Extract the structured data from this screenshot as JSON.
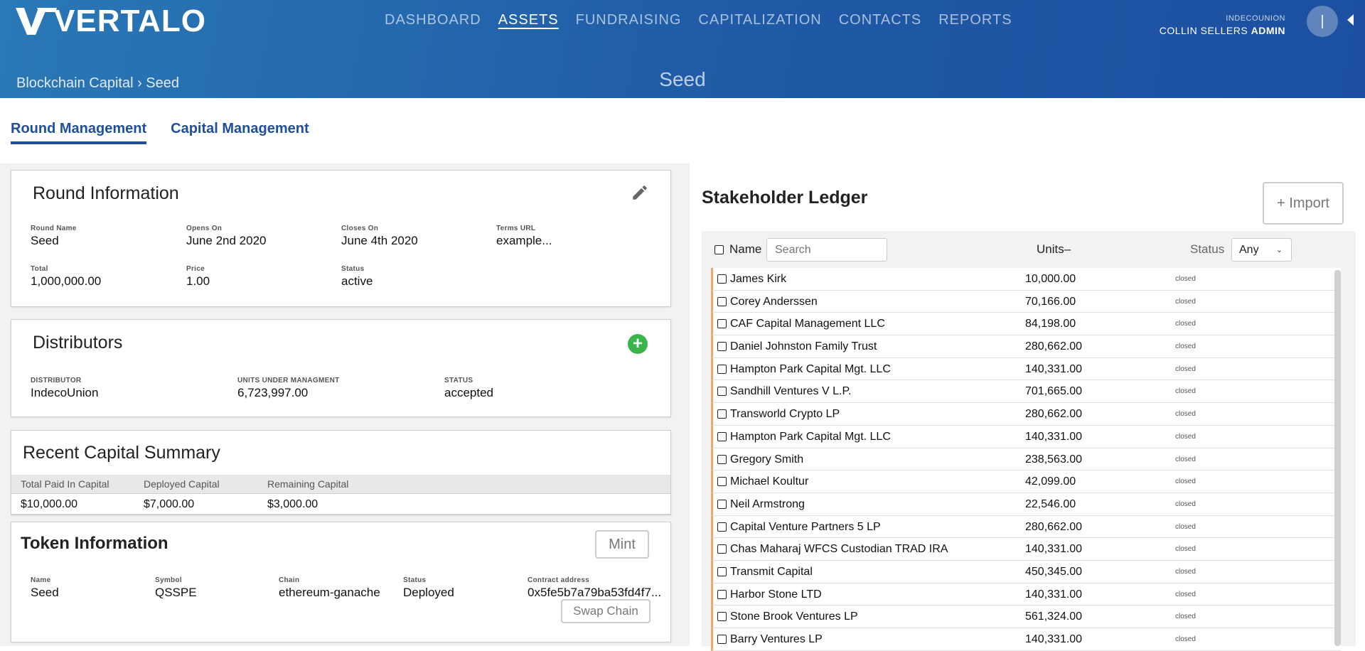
{
  "header": {
    "logo_text": "VERTALO",
    "nav": [
      "DASHBOARD",
      "ASSETS",
      "FUNDRAISING",
      "CAPITALIZATION",
      "CONTACTS",
      "REPORTS"
    ],
    "active_nav": "ASSETS",
    "org": "INDECOUNION",
    "user_name": "COLLIN SELLERS",
    "user_role": "ADMIN",
    "avatar_initial": "|",
    "breadcrumb": "Blockchain Capital › Seed",
    "page_title": "Seed"
  },
  "tabs": [
    "Round Management",
    "Capital Management"
  ],
  "round_info": {
    "title": "Round Information",
    "fields": [
      {
        "label": "Round Name",
        "value": "Seed"
      },
      {
        "label": "Opens On",
        "value": "June 2nd 2020"
      },
      {
        "label": "Closes On",
        "value": "June 4th 2020"
      },
      {
        "label": "Terms URL",
        "value": "example..."
      },
      {
        "label": "Total",
        "value": "1,000,000.00"
      },
      {
        "label": "Price",
        "value": "1.00"
      },
      {
        "label": "Status",
        "value": "active"
      }
    ]
  },
  "distributors": {
    "title": "Distributors",
    "fields": [
      {
        "label": "DISTRIBUTOR",
        "value": "IndecoUnion"
      },
      {
        "label": "UNITS UNDER MANAGMENT",
        "value": "6,723,997.00"
      },
      {
        "label": "STATUS",
        "value": "accepted"
      }
    ]
  },
  "capital_summary": {
    "title": "Recent Capital Summary",
    "headers": [
      "Total Paid In Capital",
      "Deployed Capital",
      "Remaining Capital"
    ],
    "values": [
      "$10,000.00",
      "$7,000.00",
      "$3,000.00"
    ]
  },
  "token_info": {
    "title": "Token Information",
    "mint_label": "Mint",
    "swap_label": "Swap Chain",
    "fields": [
      {
        "label": "Name",
        "value": "Seed"
      },
      {
        "label": "Symbol",
        "value": "QSSPE"
      },
      {
        "label": "Chain",
        "value": "ethereum-ganache"
      },
      {
        "label": "Status",
        "value": "Deployed"
      },
      {
        "label": "Contract address",
        "value": "0x5fe5b7a79ba53fd4f7..."
      }
    ]
  },
  "ledger": {
    "title": "Stakeholder Ledger",
    "import_label": "+ Import",
    "col_name": "Name",
    "search_placeholder": "Search",
    "col_units": "Units",
    "sort_indicator": "–",
    "col_status": "Status",
    "status_filter": "Any",
    "rows": [
      {
        "name": "James Kirk",
        "units": "10,000.00",
        "status": "closed"
      },
      {
        "name": "Corey Anderssen",
        "units": "70,166.00",
        "status": "closed"
      },
      {
        "name": "CAF Capital Management LLC",
        "units": "84,198.00",
        "status": "closed"
      },
      {
        "name": "Daniel Johnston Family Trust",
        "units": "280,662.00",
        "status": "closed"
      },
      {
        "name": "Hampton Park Capital Mgt. LLC",
        "units": "140,331.00",
        "status": "closed"
      },
      {
        "name": "Sandhill Ventures V L.P.",
        "units": "701,665.00",
        "status": "closed"
      },
      {
        "name": "Transworld Crypto LP",
        "units": "280,662.00",
        "status": "closed"
      },
      {
        "name": "Hampton Park Capital Mgt. LLC",
        "units": "140,331.00",
        "status": "closed"
      },
      {
        "name": "Gregory Smith",
        "units": "238,563.00",
        "status": "closed"
      },
      {
        "name": "Michael Koultur",
        "units": "42,099.00",
        "status": "closed"
      },
      {
        "name": "Neil Armstrong",
        "units": "22,546.00",
        "status": "closed"
      },
      {
        "name": "Capital Venture Partners 5 LP",
        "units": "280,662.00",
        "status": "closed"
      },
      {
        "name": "Chas Maharaj WFCS Custodian TRAD IRA",
        "units": "140,331.00",
        "status": "closed"
      },
      {
        "name": "Transmit Capital",
        "units": "450,345.00",
        "status": "closed"
      },
      {
        "name": "Harbor Stone LTD",
        "units": "140,331.00",
        "status": "closed"
      },
      {
        "name": "Stone Brook Ventures LP",
        "units": "561,324.00",
        "status": "closed"
      },
      {
        "name": "Barry Ventures LP",
        "units": "140,331.00",
        "status": "closed"
      }
    ]
  },
  "colors": {
    "header_start": "#2a78b6",
    "header_end": "#1c4fa0",
    "tab_accent": "#1f4e9c",
    "add_green": "#3bb54a",
    "row_marker": "#f0a868"
  }
}
